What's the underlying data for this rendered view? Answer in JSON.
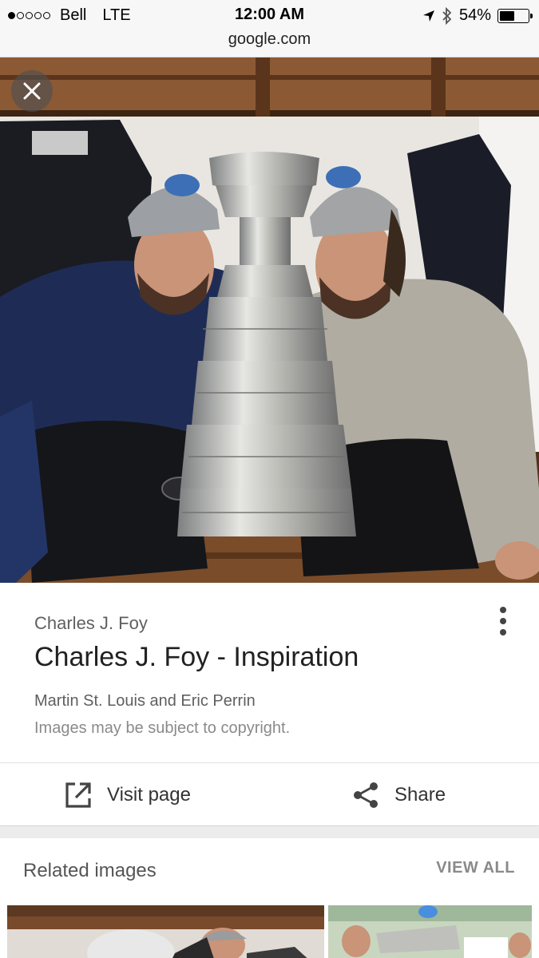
{
  "status_bar": {
    "carrier": "Bell",
    "network": "LTE",
    "time": "12:00 AM",
    "url": "google.com",
    "battery_percent": "54%",
    "battery_level": 0.54,
    "signal_bars": 1,
    "icons": [
      "location-arrow-icon",
      "bluetooth-icon",
      "battery-icon"
    ]
  },
  "viewer": {
    "close_icon": "close-icon",
    "source": "Charles J. Foy",
    "title": "Charles J. Foy - Inspiration",
    "description": "Martin St. Louis and Eric Perrin",
    "copyright": "Images may be subject to copyright.",
    "more_icon": "more-vertical-icon"
  },
  "actions": {
    "visit_label": "Visit page",
    "visit_icon": "open-in-new-icon",
    "share_label": "Share",
    "share_icon": "share-icon"
  },
  "related": {
    "title": "Related images",
    "view_all": "VIEW ALL"
  },
  "colors": {
    "status_bg": "#f7f7f7",
    "text_primary": "#212121",
    "text_secondary": "#5f5f5f",
    "divider": "#ececec"
  }
}
